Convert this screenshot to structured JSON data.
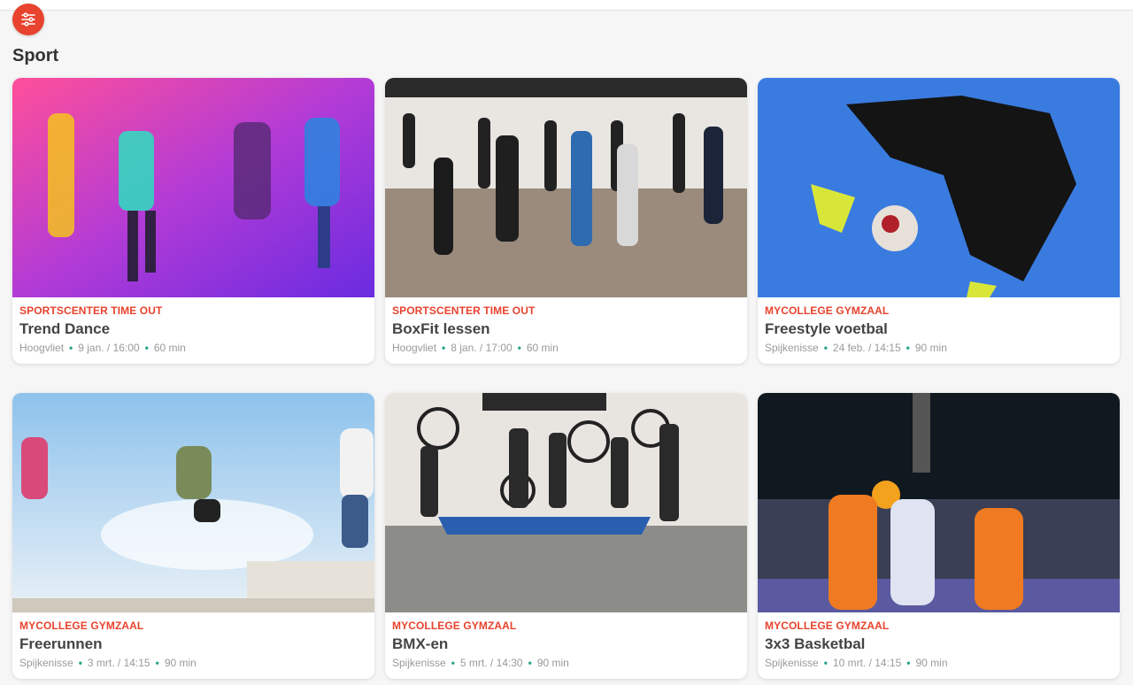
{
  "section": {
    "title": "Sport"
  },
  "filter_button": {
    "icon": "sliders-icon",
    "color": "#e8432e"
  },
  "cards": [
    {
      "org": "SPORTSCENTER TIME OUT",
      "title": "Trend Dance",
      "location": "Hoogvliet",
      "datetime": "9 jan. / 16:00",
      "duration": "60 min"
    },
    {
      "org": "SPORTSCENTER TIME OUT",
      "title": "BoxFit lessen",
      "location": "Hoogvliet",
      "datetime": "8 jan. / 17:00",
      "duration": "60 min"
    },
    {
      "org": "MYCOLLEGE GYMZAAL",
      "title": "Freestyle voetbal",
      "location": "Spijkenisse",
      "datetime": "24 feb. / 14:15",
      "duration": "90 min"
    },
    {
      "org": "MYCOLLEGE GYMZAAL",
      "title": "Freerunnen",
      "location": "Spijkenisse",
      "datetime": "3 mrt. / 14:15",
      "duration": "90 min"
    },
    {
      "org": "MYCOLLEGE GYMZAAL",
      "title": "BMX-en",
      "location": "Spijkenisse",
      "datetime": "5 mrt. / 14:30",
      "duration": "90 min"
    },
    {
      "org": "MYCOLLEGE GYMZAAL",
      "title": "3x3 Basketbal",
      "location": "Spijkenisse",
      "datetime": "10 mrt. / 14:15",
      "duration": "90 min"
    }
  ],
  "colors": {
    "accent": "#e8432e",
    "dot": "#2aa58a",
    "meta": "#9a9a9a"
  }
}
